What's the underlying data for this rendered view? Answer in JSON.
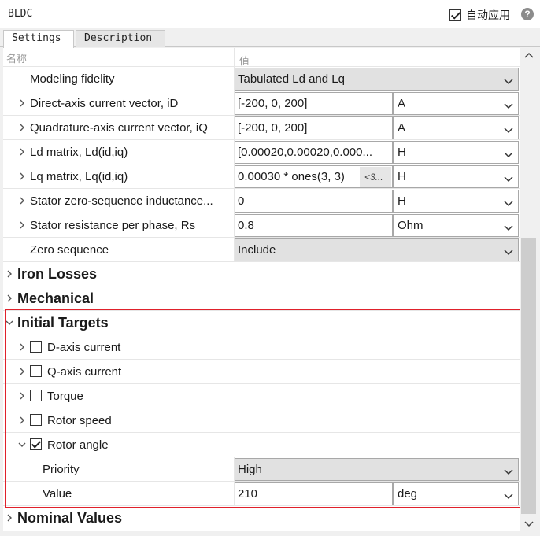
{
  "window": {
    "title": "BLDC",
    "auto_apply_label": "自动应用",
    "auto_apply_checked": true,
    "help_icon": "help-icon"
  },
  "tabs": [
    {
      "label": "Settings",
      "active": true
    },
    {
      "label": "Description",
      "active": false
    }
  ],
  "grid_header": {
    "name_col": "名称",
    "value_col": "值"
  },
  "params": {
    "modeling_fidelity": {
      "label": "Modeling fidelity",
      "value": "Tabulated Ld and Lq"
    },
    "id_vector": {
      "label": "Direct-axis current vector, iD",
      "value": "[-200, 0, 200]",
      "unit": "A"
    },
    "iq_vector": {
      "label": "Quadrature-axis current vector, iQ",
      "value": "[-200, 0, 200]",
      "unit": "A"
    },
    "ld_matrix": {
      "label": "Ld matrix, Ld(id,iq)",
      "value": "[0.00020,0.00020,0.000...",
      "unit": "H"
    },
    "lq_matrix": {
      "label": "Lq matrix, Lq(id,iq)",
      "value": "0.00030 * ones(3, 3)",
      "tag": "<3...",
      "unit": "H"
    },
    "stator_zero_seq": {
      "label": "Stator zero-sequence inductance...",
      "value": "0",
      "unit": "H"
    },
    "stator_res": {
      "label": "Stator resistance per phase, Rs",
      "value": "0.8",
      "unit": "Ohm"
    },
    "zero_sequence": {
      "label": "Zero sequence",
      "value": "Include"
    }
  },
  "sections": {
    "iron_losses": "Iron Losses",
    "mechanical": "Mechanical",
    "initial_targets": "Initial Targets",
    "nominal_values": "Nominal Values"
  },
  "targets": {
    "d_axis": {
      "label": "D-axis current",
      "checked": false
    },
    "q_axis": {
      "label": "Q-axis current",
      "checked": false
    },
    "torque": {
      "label": "Torque",
      "checked": false
    },
    "rotor_speed": {
      "label": "Rotor speed",
      "checked": false
    },
    "rotor_angle": {
      "label": "Rotor angle",
      "checked": true
    },
    "priority": {
      "label": "Priority",
      "value": "High"
    },
    "value": {
      "label": "Value",
      "value": "210",
      "unit": "deg"
    }
  },
  "colors": {
    "highlight_border": "#e0212b",
    "dropdown_bg": "#e1e1e1"
  }
}
